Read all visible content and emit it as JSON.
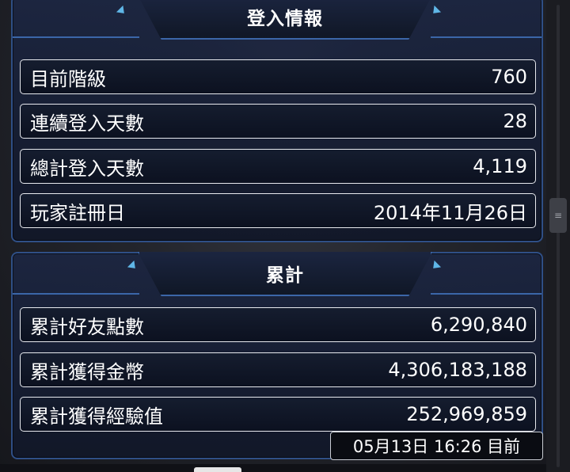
{
  "login_info": {
    "title": "登入情報",
    "rows": [
      {
        "label": "目前階級",
        "value": "760"
      },
      {
        "label": "連續登入天數",
        "value": "28"
      },
      {
        "label": "總計登入天數",
        "value": "4,119"
      },
      {
        "label": "玩家註冊日",
        "value": "2014年11月26日"
      }
    ]
  },
  "totals": {
    "title": "累計",
    "rows": [
      {
        "label": "累計好友點數",
        "value": "6,290,840"
      },
      {
        "label": "累計獲得金幣",
        "value": "4,306,183,188"
      },
      {
        "label": "累計獲得經驗值",
        "value": "252,969,859"
      }
    ]
  },
  "timestamp": "05月13日 16:26 目前",
  "icons": {
    "scroll_handle": "scroll-grip-icon"
  },
  "colors": {
    "panel_border": "#2f4f86",
    "accent": "#5fb6e6",
    "row_border": "#e7e9ee"
  }
}
